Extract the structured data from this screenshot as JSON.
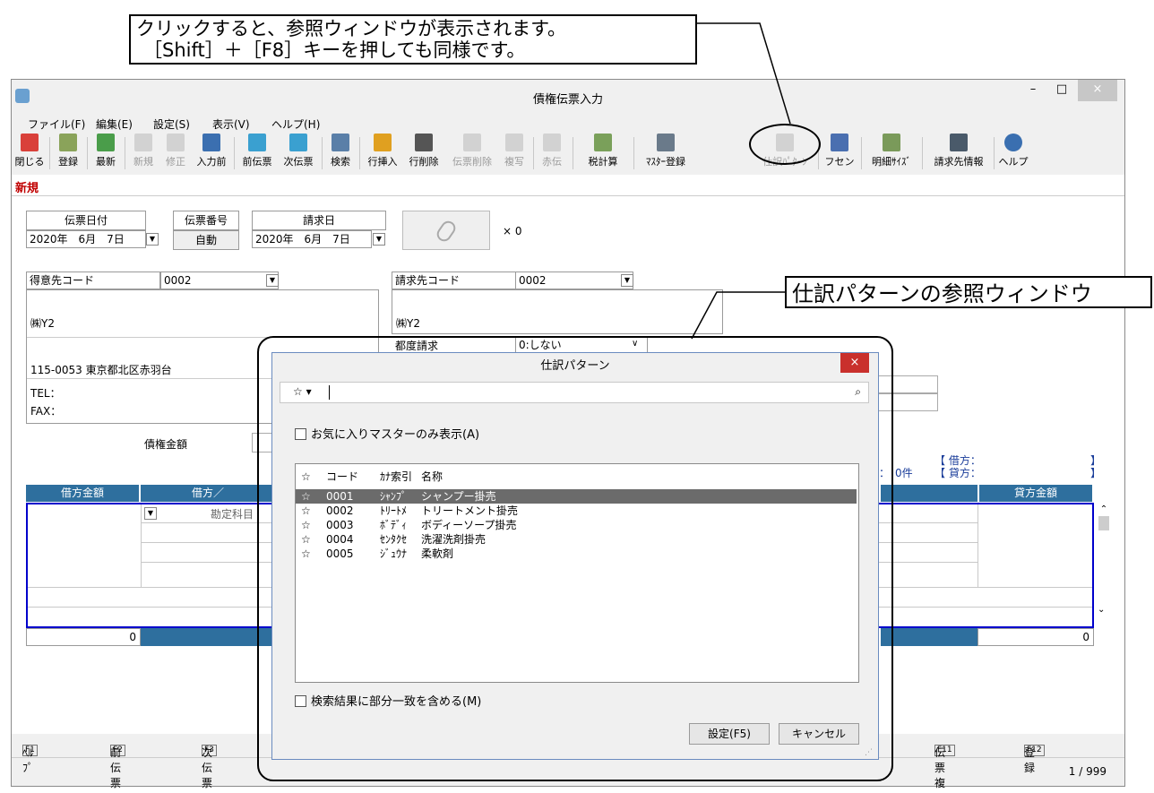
{
  "callout_top": {
    "line1": "クリックすると、参照ウィンドウが表示されます。",
    "line2": "［Shift］＋［F8］キーを押しても同様です。"
  },
  "callout_right": {
    "text": "仕訳パターンの参照ウィンドウ"
  },
  "window": {
    "title": "債権伝票入力",
    "minimize": "–",
    "maximize": "□",
    "close": "×"
  },
  "menu": [
    "ファイル(F)",
    "編集(E)",
    "設定(S)",
    "表示(V)",
    "ヘルプ(H)"
  ],
  "toolbar": [
    {
      "label": "閉じる",
      "icon": "close-icon",
      "color": "#d9403a"
    },
    {
      "label": "登録",
      "icon": "register-icon",
      "color": "#8aa35a"
    },
    {
      "label": "最新",
      "icon": "refresh-icon",
      "color": "#4a9d4a"
    },
    {
      "label": "新規",
      "icon": "new-icon",
      "color": "#9a9a9a"
    },
    {
      "label": "修正",
      "icon": "edit-icon",
      "color": "#9a9a9a"
    },
    {
      "label": "入力前",
      "icon": "undo-icon",
      "color": "#3b6fb0"
    },
    {
      "label": "前伝票",
      "icon": "prev-icon",
      "color": "#3aa0d0"
    },
    {
      "label": "次伝票",
      "icon": "next-icon",
      "color": "#3aa0d0"
    },
    {
      "label": "検索",
      "icon": "search-icon",
      "color": "#5a7fa8"
    },
    {
      "label": "行挿入",
      "icon": "insert-row-icon",
      "color": "#e0a020"
    },
    {
      "label": "行削除",
      "icon": "delete-row-icon",
      "color": "#555555"
    },
    {
      "label": "伝票削除",
      "icon": "delete-slip-icon",
      "color": "#9a9a9a"
    },
    {
      "label": "複写",
      "icon": "copy-icon",
      "color": "#9a9a9a"
    },
    {
      "label": "赤伝",
      "icon": "red-slip-icon",
      "color": "#9a9a9a"
    },
    {
      "label": "税計算",
      "icon": "tax-icon",
      "color": "#7aa05a"
    },
    {
      "label": "ﾏｽﾀｰ登録",
      "icon": "master-icon",
      "color": "#6a7a8a"
    },
    {
      "label": "仕訳ﾊﾟﾀｰﾝ",
      "icon": "pattern-icon",
      "color": "#9a9a9a"
    },
    {
      "label": "フセン",
      "icon": "sticky-icon",
      "color": "#4a6fb0"
    },
    {
      "label": "明細ｻｲｽﾞ",
      "icon": "detail-size-icon",
      "color": "#7a9a5a"
    },
    {
      "label": "請求先情報",
      "icon": "billing-icon",
      "color": "#4a5a6a"
    },
    {
      "label": "ヘルプ",
      "icon": "help-icon",
      "color": "#3a6fb0"
    }
  ],
  "tab": {
    "label": "新規"
  },
  "form": {
    "slip_date_label": "伝票日付",
    "slip_date": "2020年　6月　7日",
    "slip_no_label": "伝票番号",
    "slip_no": "自動",
    "bill_date_label": "請求日",
    "bill_date": "2020年　6月　7日",
    "attach_count": "× 0",
    "customer_code_label": "得意先コード",
    "customer_code": "0002",
    "customer_name": "㈱Y2",
    "customer_address": "115-0053 東京都北区赤羽台",
    "tel_label": "TEL：",
    "fax_label": "FAX：",
    "billing_code_label": "請求先コード",
    "billing_code": "0002",
    "billing_name": "㈱Y2",
    "per_bill_label": "都度請求",
    "per_bill_value": "0:しない",
    "claim_amount_label": "債権金額",
    "debit_summary": "【 借方：",
    "credit_summary": "【 貸方：",
    "bracket_close": "】",
    "count_text": "数：　0件",
    "col_debit_amount": "借方金額",
    "col_debit": "借方／",
    "col_credit_amount": "貸方金額",
    "account_placeholder": "勘定科目",
    "debit_total": "0",
    "credit_total": "0"
  },
  "fkeys": [
    {
      "key": "F1",
      "label": "ﾍﾙﾌﾟ"
    },
    {
      "key": "F2",
      "label": "前伝票"
    },
    {
      "key": "F3",
      "label": "次伝票"
    },
    {
      "key": "F11",
      "label": "伝票複写"
    },
    {
      "key": "F12",
      "label": "登録"
    }
  ],
  "status": {
    "page": "1 / 999"
  },
  "dialog": {
    "title": "仕訳パターン",
    "close": "×",
    "star": "☆",
    "favorites_only": "お気に入りマスターのみ表示(A)",
    "columns": {
      "star": "☆",
      "code": "コード",
      "kana": "ｶﾅ索引",
      "name": "名称"
    },
    "rows": [
      {
        "star": "☆",
        "code": "0001",
        "kana": "ｼｬﾝﾌﾟ",
        "name": "シャンプー掛売",
        "selected": true
      },
      {
        "star": "☆",
        "code": "0002",
        "kana": "ﾄﾘｰﾄﾒ",
        "name": "トリートメント掛売",
        "selected": false
      },
      {
        "star": "☆",
        "code": "0003",
        "kana": "ﾎﾞﾃﾞｨ",
        "name": "ボディーソープ掛売",
        "selected": false
      },
      {
        "star": "☆",
        "code": "0004",
        "kana": "ｾﾝﾀｸｾ",
        "name": "洗濯洗剤掛売",
        "selected": false
      },
      {
        "star": "☆",
        "code": "0005",
        "kana": "ｼﾞｭｳﾅ",
        "name": "柔軟剤",
        "selected": false
      }
    ],
    "partial_match": "検索結果に部分一致を含める(M)",
    "ok": "設定(F5)",
    "cancel": "キャンセル"
  }
}
